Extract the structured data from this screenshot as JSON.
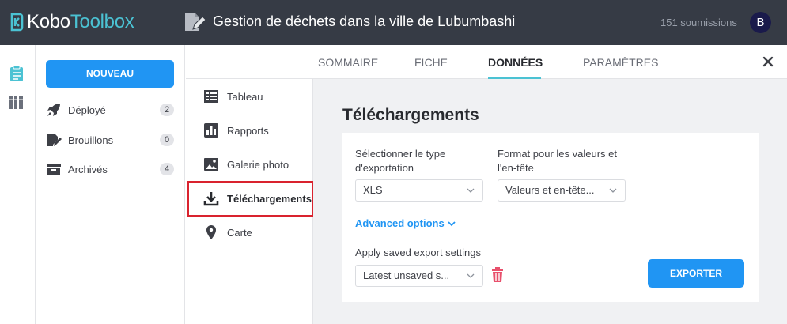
{
  "header": {
    "logo": {
      "part1": "Kobo",
      "part2": "Toolbox"
    },
    "project_title": "Gestion de déchets dans la ville de Lubumbashi",
    "submissions": "151 soumissions",
    "avatar_letter": "B"
  },
  "rail": {
    "icons": [
      "form-clipboard-icon",
      "library-books-icon"
    ]
  },
  "sidebar": {
    "new_button": "NOUVEAU",
    "items": [
      {
        "label": "Déployé",
        "count": "2",
        "icon": "rocket-icon"
      },
      {
        "label": "Brouillons",
        "count": "0",
        "icon": "draft-pencil-icon"
      },
      {
        "label": "Archivés",
        "count": "4",
        "icon": "archive-box-icon"
      }
    ]
  },
  "tabs": [
    {
      "label": "SOMMAIRE",
      "active": false
    },
    {
      "label": "FICHE",
      "active": false
    },
    {
      "label": "DONNÉES",
      "active": true
    },
    {
      "label": "PARAMÈTRES",
      "active": false
    }
  ],
  "submenu": [
    {
      "label": "Tableau",
      "icon": "table-icon",
      "active": false
    },
    {
      "label": "Rapports",
      "icon": "bar-chart-icon",
      "active": false
    },
    {
      "label": "Galerie photo",
      "icon": "photo-gallery-icon",
      "active": false
    },
    {
      "label": "Téléchargements",
      "icon": "download-icon",
      "active": true
    },
    {
      "label": "Carte",
      "icon": "map-pin-icon",
      "active": false
    }
  ],
  "downloads": {
    "title": "Téléchargements",
    "export_type_label": "Sélectionner le type d'exportation",
    "export_type_value": "XLS",
    "format_label": "Format pour les valeurs et l'en-tête",
    "format_value": "Valeurs et en-tête...",
    "advanced_options": "Advanced options",
    "saved_settings_label": "Apply saved export settings",
    "saved_settings_value": "Latest unsaved s...",
    "export_button": "EXPORTER"
  },
  "colors": {
    "topbar": "#363b45",
    "accent_blue": "#2095f3",
    "accent_teal": "#4bc2d3",
    "highlight_red": "#d9232e",
    "trash_red": "#e8506c"
  }
}
